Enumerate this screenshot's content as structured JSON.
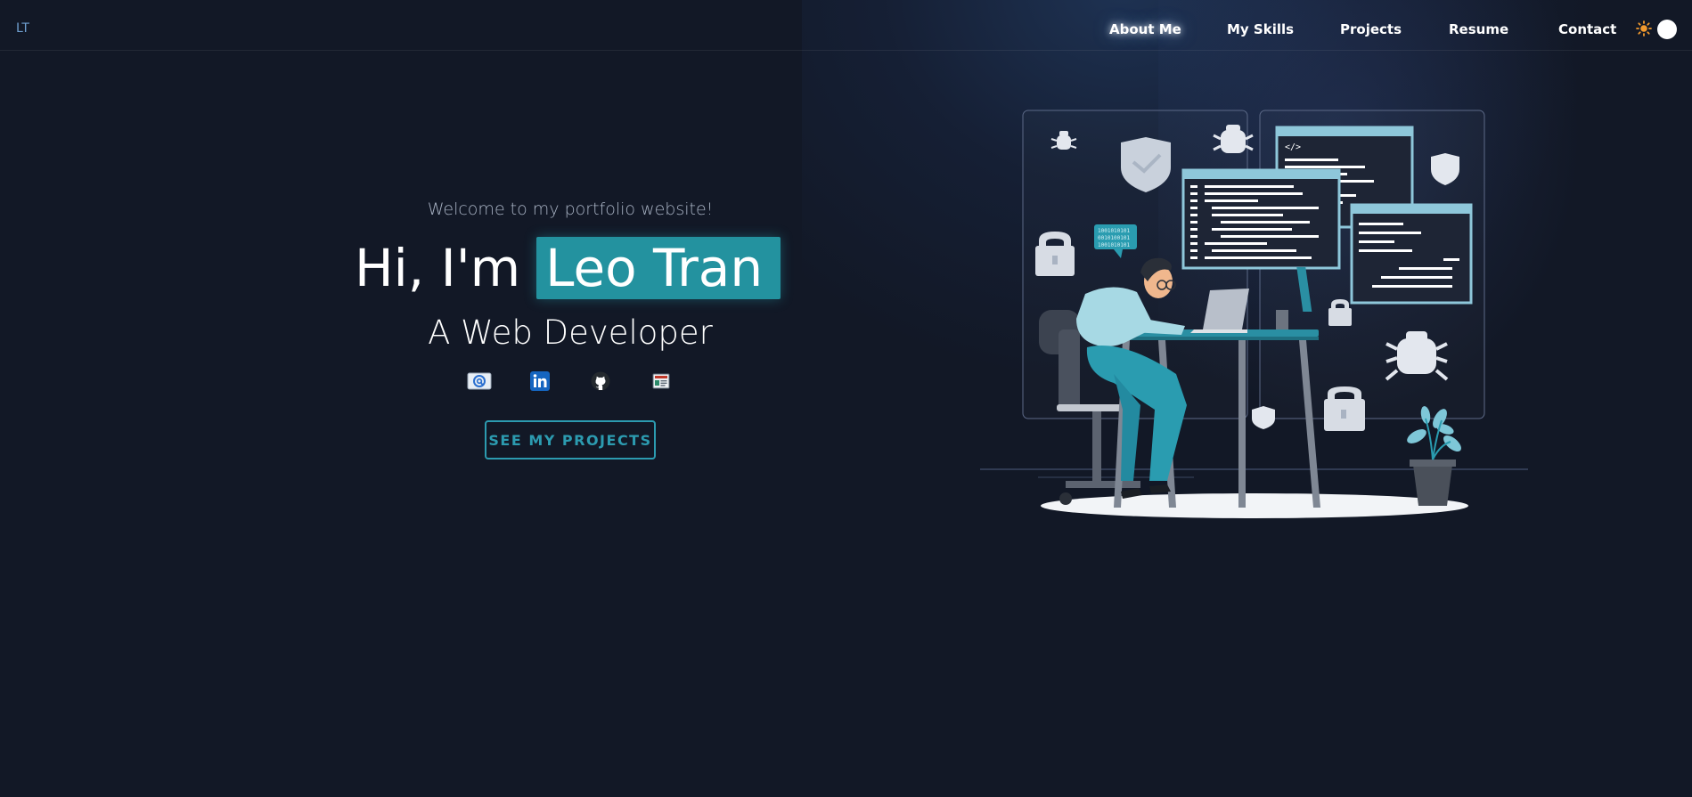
{
  "brand": {
    "logo_text": "LT"
  },
  "nav": {
    "items": [
      {
        "label": "About Me",
        "active": true
      },
      {
        "label": "My Skills",
        "active": false
      },
      {
        "label": "Projects",
        "active": false
      },
      {
        "label": "Resume",
        "active": false
      },
      {
        "label": "Contact",
        "active": false
      }
    ],
    "theme_toggle": {
      "icon": "sun-icon",
      "state": "light"
    }
  },
  "hero": {
    "welcome": "Welcome to my portfolio website!",
    "greeting_prefix": "Hi, I'm",
    "name": "Leo Tran",
    "subtitle": "A Web Developer",
    "social_icons": [
      "email-icon",
      "linkedin-icon",
      "github-icon",
      "resume-icon"
    ],
    "cta_label": "SEE MY PROJECTS"
  },
  "illustration": {
    "subject": "developer-at-desk",
    "speech_bubble": [
      "1001010101",
      "0010100101",
      "1001010101"
    ]
  },
  "colors": {
    "background": "#121826",
    "accent": "#23929f",
    "cta_border": "#2c9bb0",
    "logo": "#6f9fd1"
  }
}
